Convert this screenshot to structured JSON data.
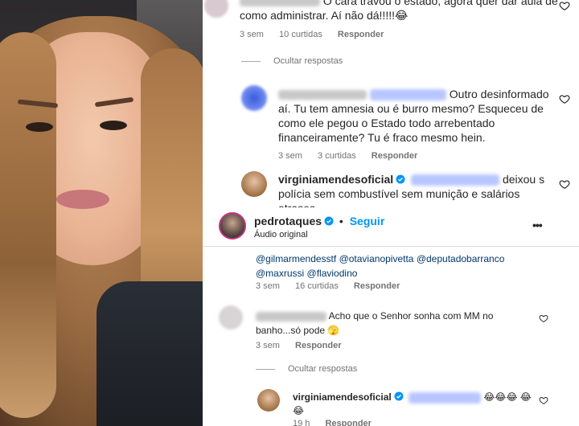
{
  "comments": [
    {
      "text": "O cara travou o estado, agora quer dar aula de como administrar. Aí não dá!!!!!😂",
      "time": "3 sem",
      "likes": "10 curtidas",
      "reply": "Responder"
    },
    {
      "text": "Outro desinformado aí. Tu tem amnesia ou é burro mesmo? Esqueceu de como ele pegou o Estado todo arrebentado financeiramente? Tu é fraco mesmo hein.",
      "time": "3 sem",
      "likes": "3 curtidas",
      "reply": "Responder"
    },
    {
      "user": "virginiamendesoficial",
      "text_after": "deixou s polícia sem combustível sem munição e salários atrasos ....",
      "time": "",
      "likes": "",
      "reply": ""
    },
    {
      "mentions": [
        "@gilmarmendesstf",
        "@otavianopivetta",
        "@deputadobarranco",
        "@maxrussi",
        "@flaviodino"
      ],
      "time": "3 sem",
      "likes": "16 curtidas",
      "reply": "Responder"
    },
    {
      "text": "Acho que o Senhor sonha com MM no banho...só pode 🫣",
      "time": "3 sem",
      "reply": "Responder"
    },
    {
      "user": "virginiamendesoficial",
      "text_after": "😂😂😂 😂😂",
      "time": "19 h",
      "reply": "Responder"
    }
  ],
  "hide_replies_label": "Ocultar respostas",
  "post": {
    "user": "pedrotaques",
    "follow": "Seguir",
    "audio": "Áudio original",
    "more_label": "•••"
  },
  "colors": {
    "follow": "#0095f6",
    "mention": "#00376b",
    "verified": "#0095f6",
    "meta": "#737373"
  },
  "icons": {
    "heart": "heart-outline-icon",
    "verified": "verified-badge-icon",
    "more": "more-options-icon"
  }
}
